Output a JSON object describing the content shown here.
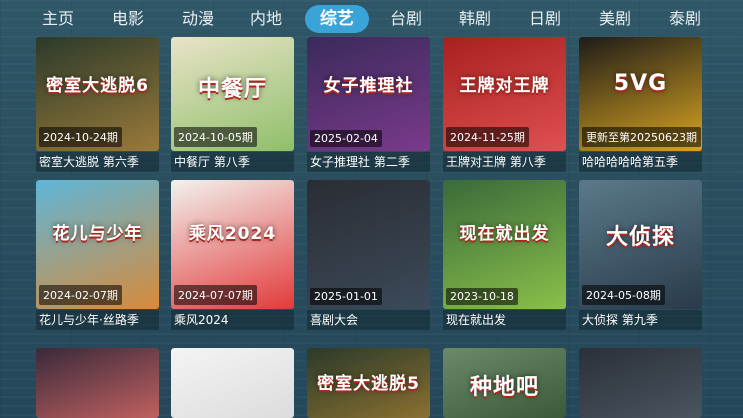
{
  "nav": {
    "tabs": [
      {
        "label": "主页"
      },
      {
        "label": "电影"
      },
      {
        "label": "动漫"
      },
      {
        "label": "内地"
      },
      {
        "label": "综艺"
      },
      {
        "label": "台剧"
      },
      {
        "label": "韩剧"
      },
      {
        "label": "日剧"
      },
      {
        "label": "美剧"
      },
      {
        "label": "泰剧"
      }
    ],
    "active_tab": "综艺",
    "active_color": "#3aa3d8"
  },
  "rows": [
    [
      {
        "title": "密室大逃脱 第六季",
        "badge": "2024-10-24期",
        "logo": "密室大逃脱6",
        "colors": [
          "#2b3a2a",
          "#9a7a3a"
        ]
      },
      {
        "title": "中餐厅 第八季",
        "badge": "2024-10-05期",
        "logo": "中餐厅",
        "colors": [
          "#e9e3c8",
          "#8fbf6a"
        ]
      },
      {
        "title": "女子推理社 第二季",
        "badge": "2025-02-04",
        "logo": "女子推理社",
        "colors": [
          "#3a2a5c",
          "#7a3a8a"
        ]
      },
      {
        "title": "王牌对王牌 第八季",
        "badge": "2024-11-25期",
        "logo": "王牌对王牌",
        "colors": [
          "#a82020",
          "#e05050"
        ]
      },
      {
        "title": "哈哈哈哈哈第五季",
        "badge": "更新至第20250623期",
        "logo": "5VG",
        "colors": [
          "#1e1c1a",
          "#d9a520"
        ]
      }
    ],
    [
      {
        "title": "花儿与少年·丝路季",
        "badge": "2024-02-07期",
        "logo": "花儿与少年",
        "colors": [
          "#5fb6d8",
          "#d88a3a"
        ]
      },
      {
        "title": "乘风2024",
        "badge": "2024-07-07期",
        "logo": "乘风2024",
        "colors": [
          "#f2f2ee",
          "#e23a3a"
        ]
      },
      {
        "title": "喜剧大会",
        "badge": "2025-01-01",
        "logo": "",
        "colors": [
          "#2a2d33",
          "#3c4a5a"
        ]
      },
      {
        "title": "现在就出发",
        "badge": "2023-10-18",
        "logo": "现在就出发",
        "colors": [
          "#3a6a3a",
          "#8ac04a"
        ]
      },
      {
        "title": "大侦探 第九季",
        "badge": "2024-05-08期",
        "logo": "大侦探",
        "colors": [
          "#5a7a8a",
          "#2a3a4a"
        ]
      }
    ],
    [
      {
        "title": "",
        "badge": "",
        "logo": "",
        "colors": [
          "#3a2a3a",
          "#c06060"
        ]
      },
      {
        "title": "",
        "badge": "",
        "logo": "",
        "colors": [
          "#f4f4f4",
          "#dcdcdc"
        ]
      },
      {
        "title": "",
        "badge": "",
        "logo": "密室大逃脱5",
        "colors": [
          "#2a3a2a",
          "#8a7030"
        ]
      },
      {
        "title": "",
        "badge": "",
        "logo": "种地吧",
        "colors": [
          "#6a8a6a",
          "#3a5a3a"
        ]
      },
      {
        "title": "",
        "badge": "",
        "logo": "",
        "colors": [
          "#2a3038",
          "#4a5560"
        ]
      }
    ]
  ]
}
